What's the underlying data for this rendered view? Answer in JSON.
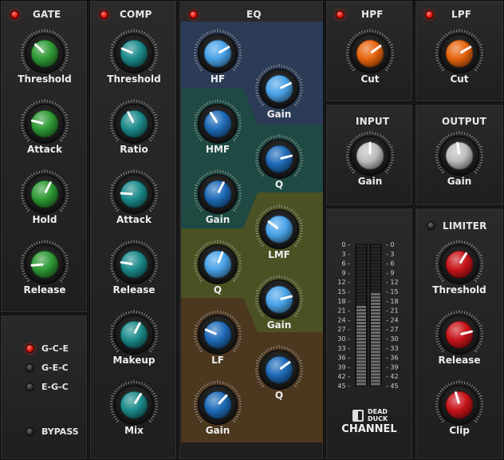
{
  "colors": {
    "green": "#2e9a35",
    "teal": "#1c8b8a",
    "blue_light": "#4aa3e8",
    "blue_dark": "#1f6bb8",
    "orange": "#e8650f",
    "gray": "#bdbdbd",
    "red": "#c8141a",
    "eq_hf_band": "#2c3d5a",
    "eq_hmf_band": "#1d4c44",
    "eq_lmf_band": "#4e5424",
    "eq_lf_band": "#4f3920",
    "led_on": "#e21a12"
  },
  "gate": {
    "title": "GATE",
    "knobs": [
      {
        "label": "Threshold",
        "value": 0.33
      },
      {
        "label": "Attack",
        "value": 0.22
      },
      {
        "label": "Hold",
        "value": 0.6
      },
      {
        "label": "Release",
        "value": 0.15
      }
    ]
  },
  "routing": {
    "options": [
      {
        "label": "G-C-E",
        "active": true
      },
      {
        "label": "G-E-C",
        "active": false
      },
      {
        "label": "E-G-C",
        "active": false
      }
    ],
    "bypass_label": "BYPASS"
  },
  "comp": {
    "title": "COMP",
    "knobs": [
      {
        "label": "Threshold",
        "value": 0.25
      },
      {
        "label": "Ratio",
        "value": 0.4
      },
      {
        "label": "Attack",
        "value": 0.18
      },
      {
        "label": "Release",
        "value": 0.2
      },
      {
        "label": "Makeup",
        "value": 0.6
      },
      {
        "label": "Mix",
        "value": 0.62
      }
    ]
  },
  "eq": {
    "title": "EQ",
    "bands": [
      {
        "name": "HF",
        "knobs": [
          {
            "label": "HF",
            "value": 0.72
          },
          {
            "label": "Gain",
            "value": 0.74
          }
        ]
      },
      {
        "name": "HMF",
        "knobs": [
          {
            "label": "HMF",
            "value": 0.38
          },
          {
            "label": "Q",
            "value": 0.78
          },
          {
            "label": "Gain",
            "value": 0.6
          }
        ]
      },
      {
        "name": "LMF",
        "knobs": [
          {
            "label": "LMF",
            "value": 0.3
          },
          {
            "label": "Q",
            "value": 0.58
          },
          {
            "label": "Gain",
            "value": 0.78
          }
        ]
      },
      {
        "name": "LF",
        "knobs": [
          {
            "label": "LF",
            "value": 0.25
          },
          {
            "label": "Q",
            "value": 0.7
          },
          {
            "label": "Gain",
            "value": 0.66
          }
        ]
      }
    ]
  },
  "hpf": {
    "title": "HPF",
    "knob": {
      "label": "Cut",
      "value": 0.7
    }
  },
  "lpf": {
    "title": "LPF",
    "knob": {
      "label": "Cut",
      "value": 0.72
    }
  },
  "input": {
    "title": "INPUT",
    "knob": {
      "label": "Gain",
      "value": 0.5
    }
  },
  "output": {
    "title": "OUTPUT",
    "knob": {
      "label": "Gain",
      "value": 0.47
    }
  },
  "limiter": {
    "title": "LIMITER",
    "knobs": [
      {
        "label": "Threshold",
        "value": 0.62
      },
      {
        "label": "Release",
        "value": 0.78
      },
      {
        "label": "Clip",
        "value": 0.44
      }
    ]
  },
  "meter": {
    "scale": [
      "0",
      "3",
      "6",
      "9",
      "12",
      "15",
      "18",
      "21",
      "24",
      "27",
      "30",
      "33",
      "36",
      "39",
      "42",
      "45"
    ],
    "level_left": 0.58,
    "level_right": 0.66
  },
  "brand": {
    "logo_line1": "DEAD",
    "logo_line2": "DUCK",
    "product": "CHANNEL"
  }
}
